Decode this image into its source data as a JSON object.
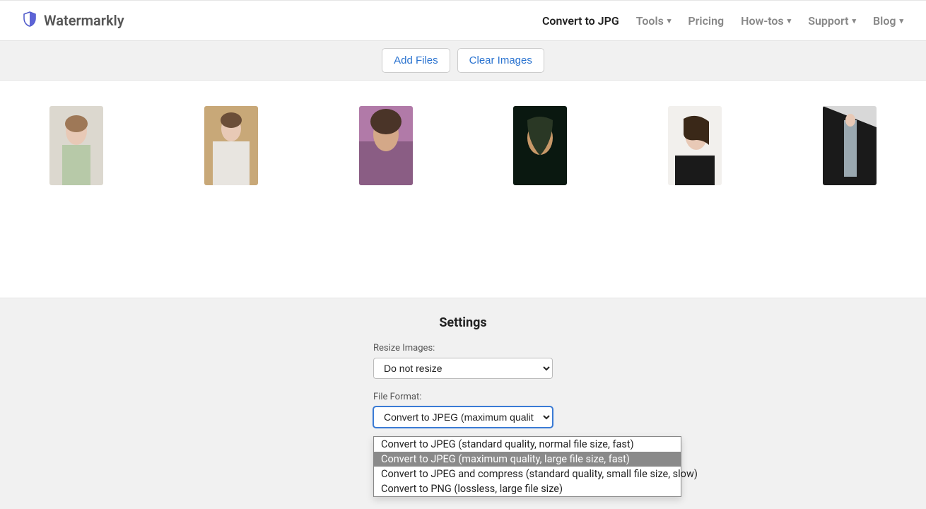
{
  "brand": "Watermarkly",
  "nav": {
    "convert": "Convert to JPG",
    "tools": "Tools",
    "pricing": "Pricing",
    "howtos": "How-tos",
    "support": "Support",
    "blog": "Blog"
  },
  "toolbar": {
    "add_files": "Add Files",
    "clear_images": "Clear Images"
  },
  "settings": {
    "title": "Settings",
    "resize_label": "Resize Images:",
    "resize_value": "Do not resize",
    "format_label": "File Format:",
    "format_value": "Convert to JPEG (maximum quality,",
    "format_options": [
      "Convert to JPEG (standard quality, normal file size, fast)",
      "Convert to JPEG (maximum quality, large file size, fast)",
      "Convert to JPEG and compress (standard quality, small file size, slow)",
      "Convert to PNG (lossless, large file size)"
    ],
    "format_selected_index": 1
  }
}
